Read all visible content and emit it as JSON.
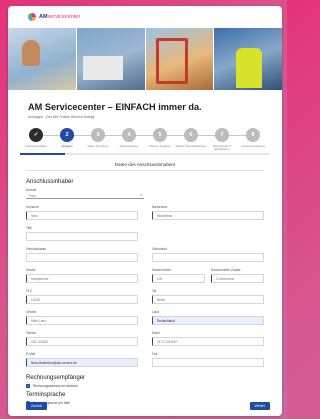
{
  "brand": {
    "name_bold": "AM",
    "name_rest": "servicecenter"
  },
  "headline": "AM Servicecenter – EINFACH immer da.",
  "subline": "Anzeigen - Der AM Online-Service Antrag",
  "steps": [
    {
      "number": "1",
      "label": "Anschlussinhaber",
      "state": "done"
    },
    {
      "number": "2",
      "label": "Anliegen",
      "state": "active"
    },
    {
      "number": "3",
      "label": "Daten Anschluss",
      "state": "todo"
    },
    {
      "number": "4",
      "label": "Zahlungsweise",
      "state": "todo"
    },
    {
      "number": "5",
      "label": "Weitere Angaben",
      "state": "todo"
    },
    {
      "number": "6",
      "label": "Weitere Dienstleistungen",
      "state": "todo"
    },
    {
      "number": "7",
      "label": "Datenschutz & Einwilligung",
      "state": "todo"
    },
    {
      "number": "8",
      "label": "Zusammenfassung",
      "state": "todo"
    }
  ],
  "progress": 0.18,
  "section_title": "Daten des Anschlussinhabers",
  "form": {
    "heading": "Anschlussinhaber",
    "anrede_label": "Anrede",
    "anrede_value": "Frau",
    "vorname_label": "Vorname",
    "vorname_value": "Nina",
    "nachname_label": "Nachname",
    "nachname_value": "Musterfrau",
    "titel_label": "Titel",
    "geburtsdatum_label": "Geburtsdatum",
    "geburtsort_label": "Geburtsort",
    "strasse_label": "Straße",
    "strasse_value": "Hauptstraße",
    "hausnummer_label": "Hausnummer",
    "hausnummer_value": "100",
    "zusatz_label": "Hausnummer Zusatz",
    "zusatz_value": "2.Hinterhaus",
    "plz_label": "PLZ",
    "plz_value": "12345",
    "ort_label": "Ort",
    "ort_value": "Berlin",
    "ortsteil_label": "Ortsteil",
    "ortsteil_value": "Mitte-Land",
    "land_label": "Land",
    "land_value": "Deutschland",
    "telefon_label": "Telefon",
    "telefon_value": "030 123456",
    "mobil_label": "Mobil",
    "mobil_value": "0172 1234567",
    "email_label": "E-Mail",
    "email_value": "Nina.Musterfrau@am-service.de",
    "fax_label": "Fax"
  },
  "rechnung": {
    "heading": "Rechnungsempfänger",
    "checkbox_label": "Rechnungsadresse ist identisch"
  },
  "terminsprache": {
    "heading": "Terminsprache",
    "option_label": "Terminabsprache per Mail"
  },
  "buttons": {
    "back": "Zurück",
    "next": "Weiter"
  },
  "colors": {
    "accent": "#1f4ba5",
    "brand_pink": "#e4327a"
  }
}
